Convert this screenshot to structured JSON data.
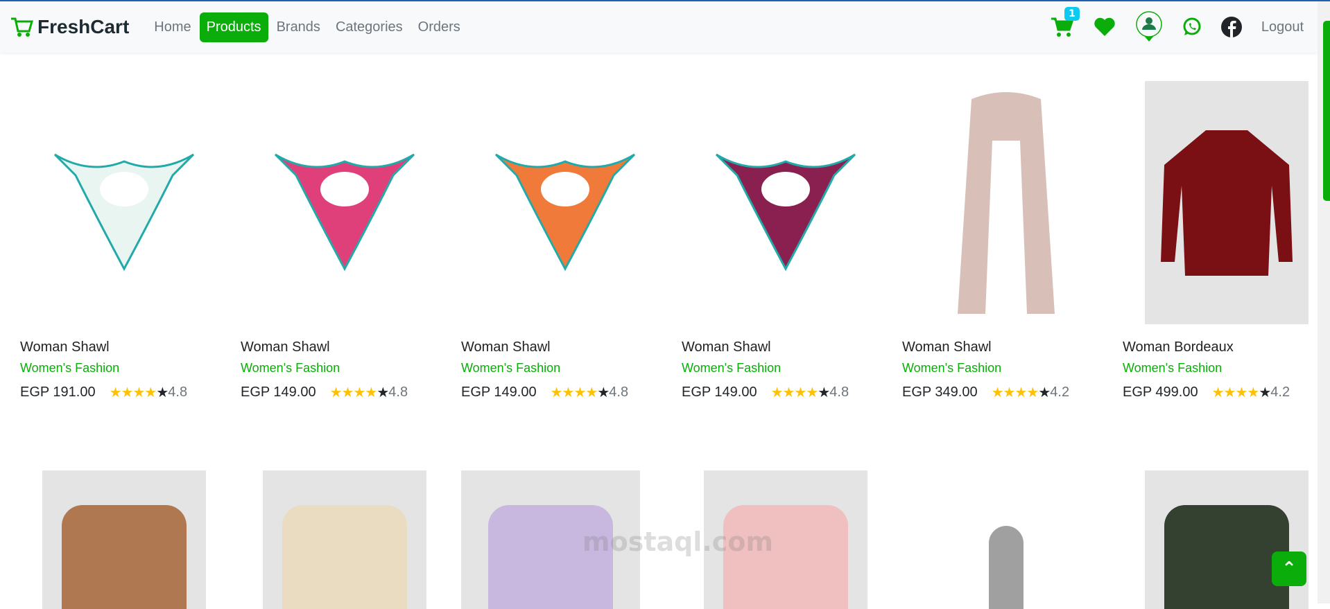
{
  "brand": "FreshCart",
  "nav": {
    "links": [
      "Home",
      "Products",
      "Brands",
      "Categories",
      "Orders"
    ],
    "active": "Products",
    "cart_count": "1",
    "logout": "Logout"
  },
  "colors": {
    "accent": "#0aad0a",
    "badge": "#0dcaf0",
    "star": "#ffc107"
  },
  "products": [
    {
      "title": "Woman Shawl",
      "category": "Women's Fashion",
      "price": "EGP 191.00",
      "rating": "4.8",
      "image_color": "#e8f5f0"
    },
    {
      "title": "Woman Shawl",
      "category": "Women's Fashion",
      "price": "EGP 149.00",
      "rating": "4.8",
      "image_color": "#e0407a"
    },
    {
      "title": "Woman Shawl",
      "category": "Women's Fashion",
      "price": "EGP 149.00",
      "rating": "4.8",
      "image_color": "#f07a3a"
    },
    {
      "title": "Woman Shawl",
      "category": "Women's Fashion",
      "price": "EGP 149.00",
      "rating": "4.8",
      "image_color": "#8a2050"
    },
    {
      "title": "Woman Shawl",
      "category": "Women's Fashion",
      "price": "EGP 349.00",
      "rating": "4.2",
      "image_color": "#d8c0b8"
    },
    {
      "title": "Woman Bordeaux",
      "category": "Women's Fashion",
      "price": "EGP 499.00",
      "rating": "4.2",
      "image_color": "#7a0f14"
    }
  ],
  "second_row_colors": [
    "#b07850",
    "#eadcc0",
    "#c8b8e0",
    "#f0c0c0",
    "#a0a0a0",
    "#344030"
  ],
  "watermark": "mostaql.com"
}
